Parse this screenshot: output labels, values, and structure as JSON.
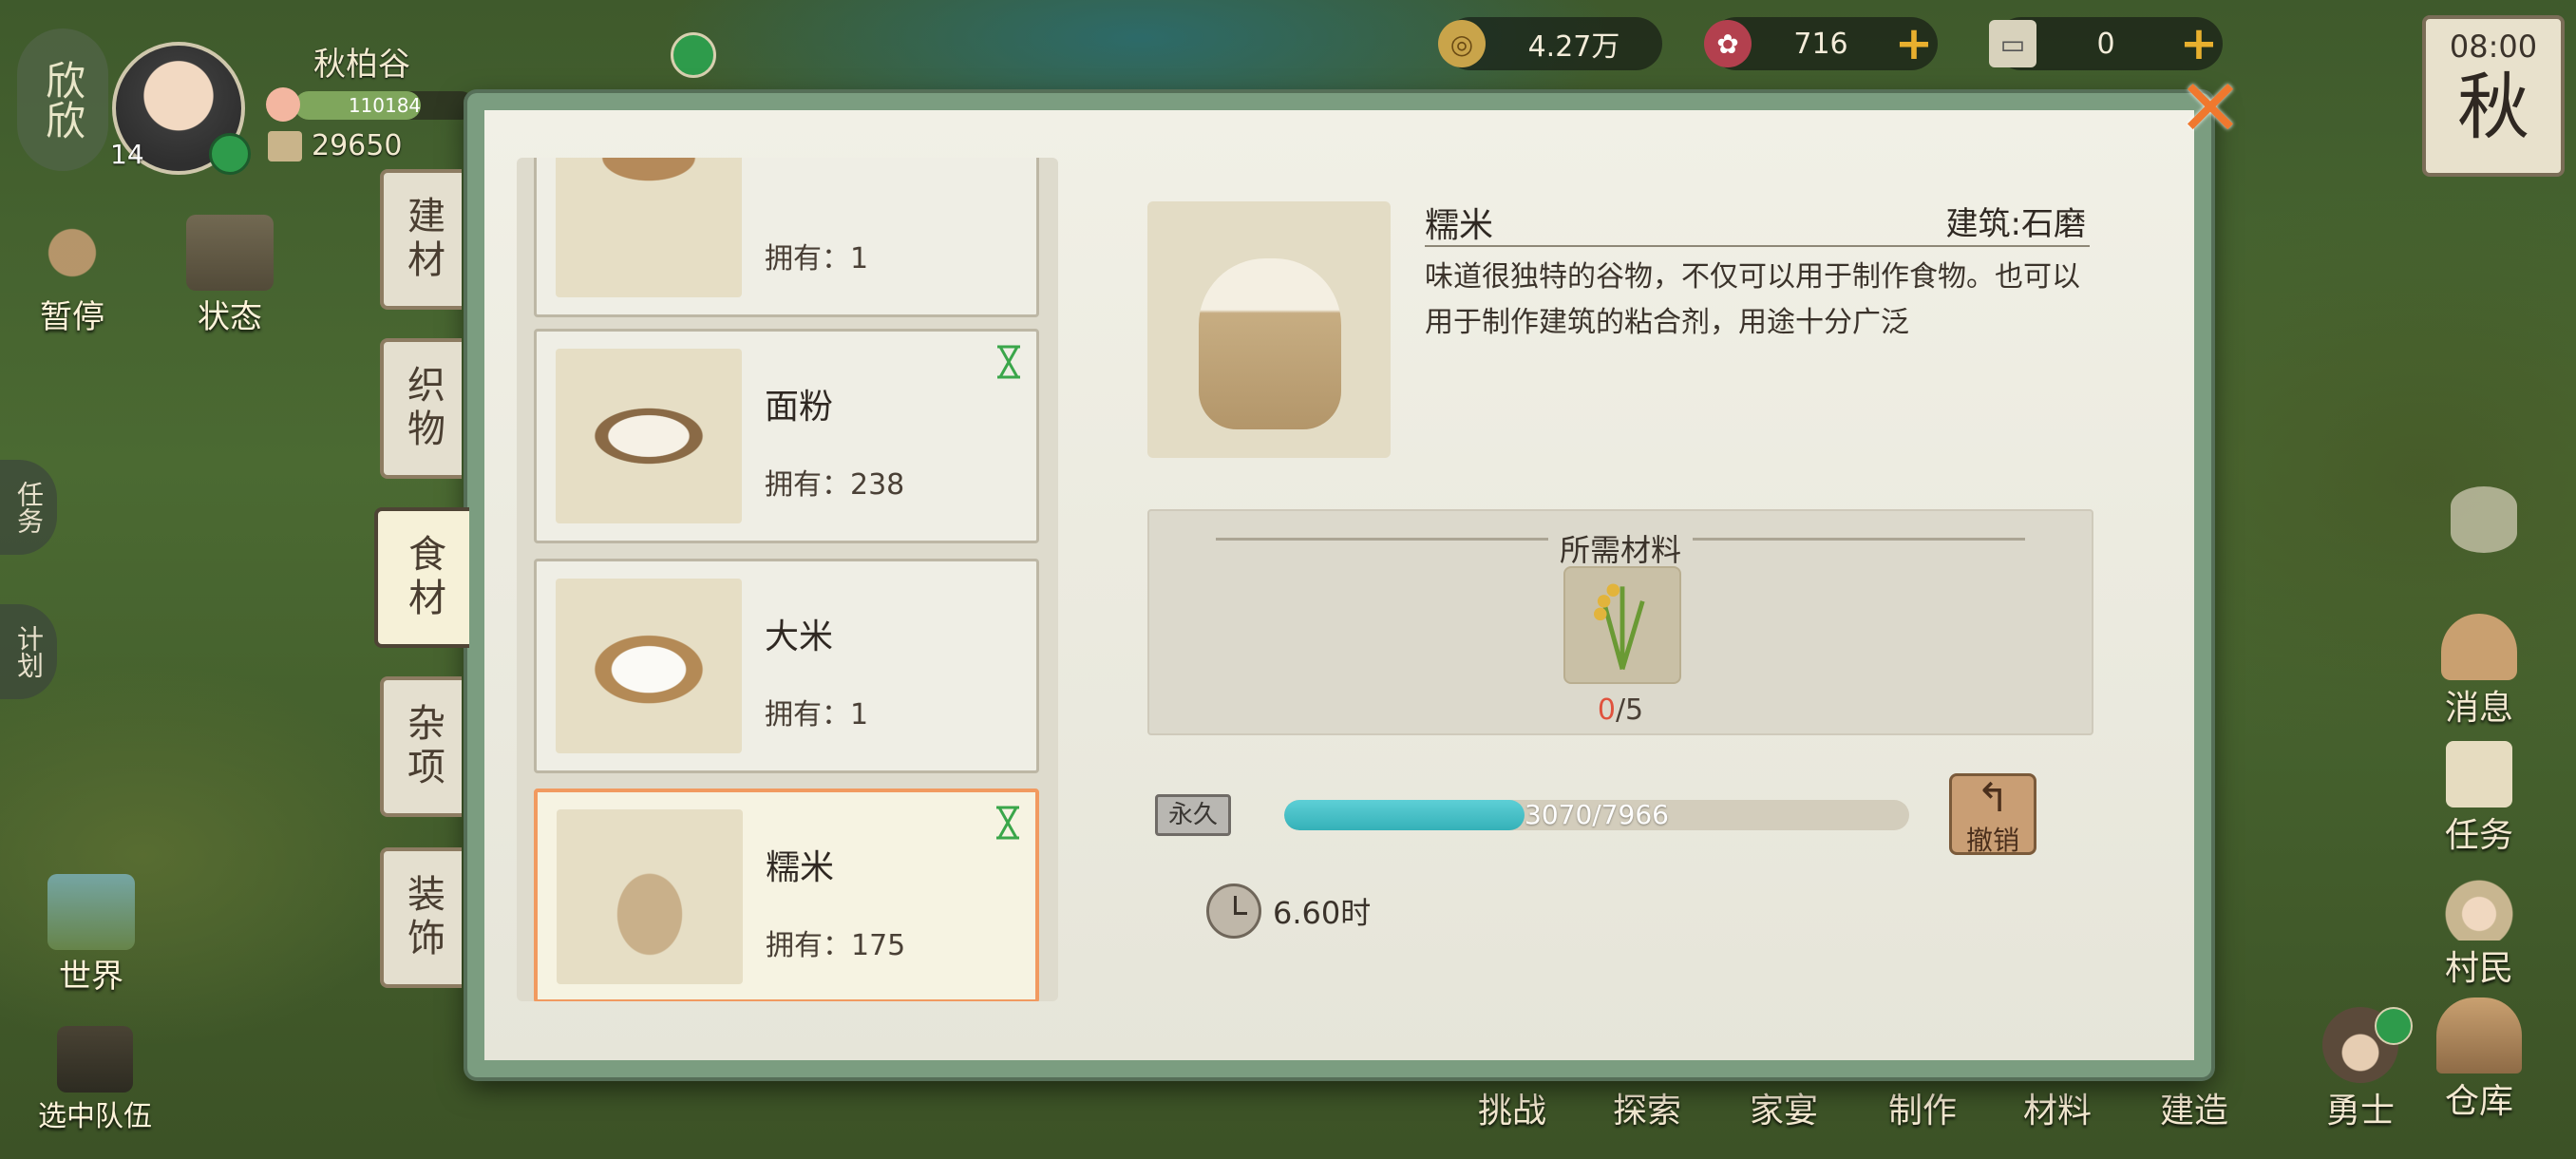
{
  "player": {
    "name": "秋柏谷",
    "short_name": "欣欣",
    "level": "14",
    "exp": "110184",
    "coins_small": "29650"
  },
  "top_bar": {
    "coins": "4.27万",
    "gems": "716",
    "tickets": "0",
    "time": "08:00",
    "season": "秋"
  },
  "left_menu": {
    "pause": "暂停",
    "status": "状态",
    "task": "任务",
    "plan": "计划",
    "world": "世界",
    "team": "选中队伍"
  },
  "tabs": [
    {
      "label": "建材"
    },
    {
      "label": "织物"
    },
    {
      "label": "食材"
    },
    {
      "label": "杂项"
    },
    {
      "label": "装饰"
    }
  ],
  "items": [
    {
      "name": "",
      "own": "拥有：1"
    },
    {
      "name": "面粉",
      "own": "拥有：238"
    },
    {
      "name": "大米",
      "own": "拥有：1"
    },
    {
      "name": "糯米",
      "own": "拥有：175"
    }
  ],
  "detail": {
    "name": "糯米",
    "building": "建筑:石磨",
    "description": "味道很独特的谷物，不仅可以用于制作食物。也可以用于制作建筑的粘合剂，用途十分广泛",
    "required_title": "所需材料",
    "req_have": "0",
    "req_need": "/5",
    "permanent": "永久",
    "progress_text": "3070/7966",
    "progress_fraction": 0.385,
    "undo": "撤销",
    "time": "6.60时"
  },
  "right_menu": {
    "message": "消息",
    "task": "任务",
    "villager": "村民",
    "hero": "勇士",
    "warehouse": "仓库"
  },
  "bottom_menu": [
    "挑战",
    "探索",
    "家宴",
    "制作",
    "材料",
    "建造"
  ],
  "colors": {
    "accent": "#f19a60",
    "progress": "#35b1b8",
    "frame": "#7b9d80",
    "close": "#f0782e"
  }
}
